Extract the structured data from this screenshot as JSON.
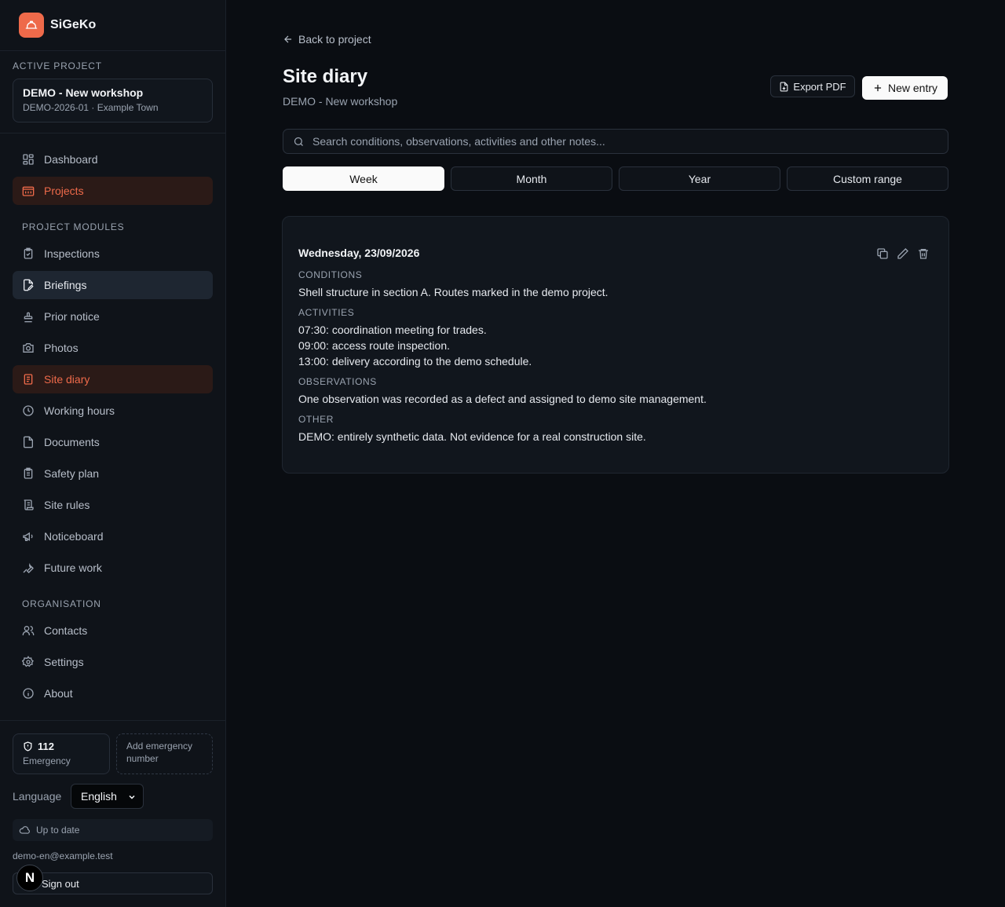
{
  "app": {
    "name": "SiGeKo"
  },
  "active_project": {
    "section_label": "ACTIVE PROJECT",
    "name": "DEMO - New workshop",
    "meta": "DEMO-2026-01 · Example Town"
  },
  "nav": {
    "dashboard": "Dashboard",
    "projects": "Projects",
    "project_modules_label": "PROJECT MODULES",
    "inspections": "Inspections",
    "briefings": "Briefings",
    "prior_notice": "Prior notice",
    "photos": "Photos",
    "site_diary": "Site diary",
    "working_hours": "Working hours",
    "documents": "Documents",
    "safety_plan": "Safety plan",
    "site_rules": "Site rules",
    "noticeboard": "Noticeboard",
    "future_work": "Future work",
    "organisation_label": "ORGANISATION",
    "contacts": "Contacts",
    "settings": "Settings",
    "about": "About"
  },
  "footer": {
    "emergency_number": "112",
    "emergency_label": "Emergency",
    "add_emergency": "Add emergency number",
    "language_label": "Language",
    "language_value": "English",
    "sync_status": "Up to date",
    "email": "demo-en@example.test",
    "sign_out": "Sign out",
    "badge": "N"
  },
  "header": {
    "back": "Back to project",
    "title": "Site diary",
    "subtitle": "DEMO - New workshop",
    "export_pdf": "Export PDF",
    "new_entry": "New entry"
  },
  "search": {
    "placeholder": "Search conditions, observations, activities and other notes..."
  },
  "tabs": [
    "Week",
    "Month",
    "Year",
    "Custom range"
  ],
  "active_tab": "Week",
  "entry": {
    "date": "Wednesday, 23/09/2026",
    "conditions_label": "CONDITIONS",
    "conditions": "Shell structure in section A. Routes marked in the demo project.",
    "activities_label": "ACTIVITIES",
    "activities": [
      "07:30: coordination meeting for trades.",
      "09:00: access route inspection.",
      "13:00: delivery according to the demo schedule."
    ],
    "observations_label": "OBSERVATIONS",
    "observations": "One observation was recorded as a defect and assigned to demo site management.",
    "other_label": "OTHER",
    "other": "DEMO: entirely synthetic data. Not evidence for a real construction site."
  },
  "colors": {
    "accent": "#ee6a4a",
    "background": "#0a0d12",
    "sidebar": "#0f1319"
  }
}
